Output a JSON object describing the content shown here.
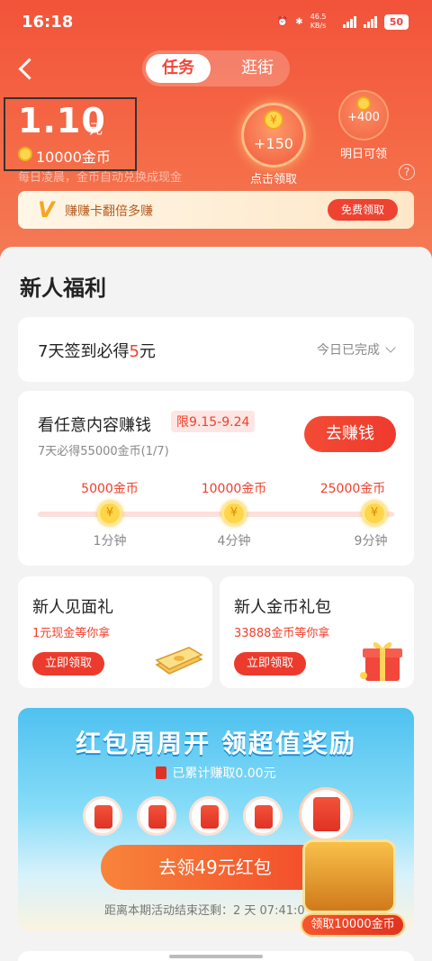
{
  "status_bar": {
    "time": "16:18",
    "net_speed": "46.5 KB/s",
    "battery": "50"
  },
  "tabs": {
    "active": "任务",
    "other": "逛街"
  },
  "balance": {
    "amount": "1.10",
    "unit": "元",
    "coins": "10000金币",
    "note": "每日凌晨，金币自动兑换成现金"
  },
  "rewards": {
    "today": {
      "value": "+150",
      "label": "点击领取"
    },
    "tomorrow": {
      "value": "+400",
      "label": "明日可领"
    },
    "help_icon": "?"
  },
  "double_card": {
    "text": "赚赚卡翻倍多赚",
    "button": "免费领取"
  },
  "section": {
    "title": "新人福利"
  },
  "sign_in": {
    "text_before": "7天签到必得",
    "highlight": "5",
    "text_after": "元",
    "status": "今日已完成"
  },
  "watch": {
    "title": "看任意内容赚钱",
    "tag": "限9.15-9.24",
    "subtitle": "7天必得55000金币(1/7)",
    "button": "去赚钱",
    "milestones": [
      {
        "amount": "5000金币",
        "time": "1分钟"
      },
      {
        "amount": "10000金币",
        "time": "4分钟"
      },
      {
        "amount": "25000金币",
        "time": "9分钟"
      }
    ],
    "coin_symbol": "¥"
  },
  "gift_cards": [
    {
      "title": "新人见面礼",
      "subtitle": "1元现金等你拿",
      "button": "立即领取"
    },
    {
      "title": "新人金币礼包",
      "subtitle": "33888金币等你拿",
      "button": "立即领取"
    }
  ],
  "red_packet": {
    "title": "红包周周开 领超值奖励",
    "cumulative": "已累计赚取0.00元",
    "button": "去领49元红包",
    "countdown": "距离本期活动结束还剩：2 天 07:41:0",
    "chest_label": "领取10000金币"
  },
  "colors": {
    "accent": "#f0402c",
    "header": "#f2533a"
  }
}
